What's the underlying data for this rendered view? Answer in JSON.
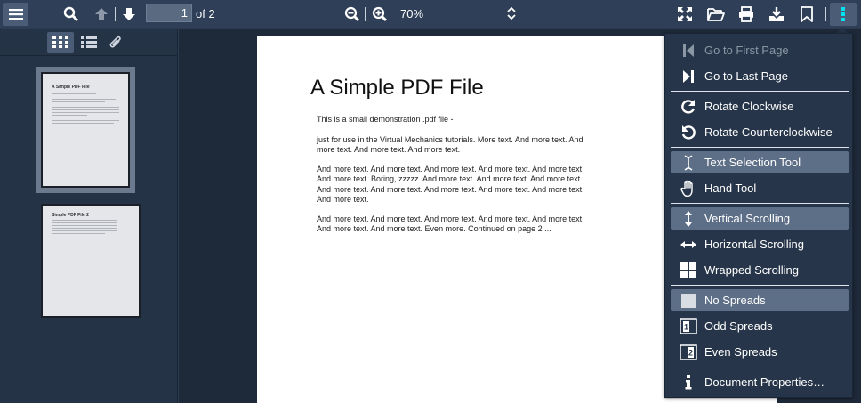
{
  "toolbar": {
    "page_number": "1",
    "page_of": "of 2",
    "zoom": "70%"
  },
  "document": {
    "title": "A Simple PDF File",
    "paragraphs": [
      "This is a small demonstration .pdf file -",
      "just for use in the Virtual Mechanics tutorials. More text. And more text. And more text. And more text. And more text.",
      "And more text. And more text. And more text. And more text. And more text. And more text. Boring, zzzzz. And more text. And more text. And more text. And more text. And more text. And more text. And more text. And more text. And more text.",
      "And more text. And more text. And more text. And more text. And more text. And more text. And more text. Even more. Continued on page 2 ..."
    ]
  },
  "thumbnails": [
    {
      "title": "A Simple PDF File",
      "selected": true
    },
    {
      "title": "Simple PDF File 2",
      "selected": false
    }
  ],
  "menu": {
    "items": [
      {
        "label": "Go to First Page",
        "icon": "first-page-icon",
        "disabled": true
      },
      {
        "label": "Go to Last Page",
        "icon": "last-page-icon"
      },
      {
        "label": "Rotate Clockwise",
        "icon": "rotate-cw-icon"
      },
      {
        "label": "Rotate Counterclockwise",
        "icon": "rotate-ccw-icon"
      },
      {
        "label": "Text Selection Tool",
        "icon": "text-cursor-icon",
        "active": true
      },
      {
        "label": "Hand Tool",
        "icon": "hand-icon"
      },
      {
        "label": "Vertical Scrolling",
        "icon": "vertical-arrows-icon",
        "active": true
      },
      {
        "label": "Horizontal Scrolling",
        "icon": "horizontal-arrows-icon"
      },
      {
        "label": "Wrapped Scrolling",
        "icon": "grid-icon"
      },
      {
        "label": "No Spreads",
        "icon": "single-page-icon",
        "active": true
      },
      {
        "label": "Odd Spreads",
        "icon": "odd-spread-icon"
      },
      {
        "label": "Even Spreads",
        "icon": "even-spread-icon"
      },
      {
        "label": "Document Properties…",
        "icon": "info-icon"
      }
    ]
  },
  "colors": {
    "toolbar": "#2e3f57",
    "menu": "#263549",
    "active": "#5d6e87",
    "accent": "#00e0f0"
  }
}
